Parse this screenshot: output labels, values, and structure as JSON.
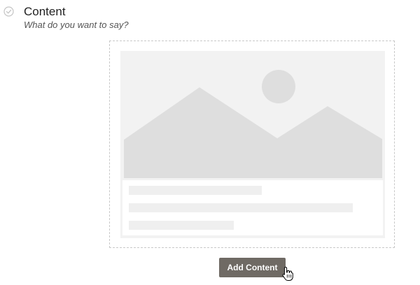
{
  "step": {
    "title": "Content",
    "subtitle": "What do you want to say?",
    "status_icon": "check-circle-icon"
  },
  "dropzone": {
    "placeholder": {
      "image_icon": "image-placeholder-icon",
      "text_line_count": 3
    }
  },
  "actions": {
    "add_content_label": "Add Content"
  },
  "cursor": {
    "icon": "hand-pointer-icon"
  },
  "colors": {
    "button_background": "#6f6a64",
    "button_text": "#ffffff",
    "placeholder_background": "#f2f2f2",
    "placeholder_shape": "#dedede",
    "dashed_border": "#c8c8c8"
  }
}
